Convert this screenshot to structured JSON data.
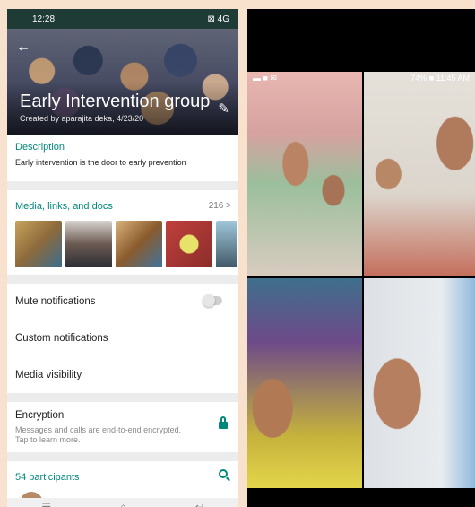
{
  "left_phone": {
    "status": {
      "time": "12:28",
      "right": "⊠ 4G"
    },
    "header": {
      "title": "Early Intervention group",
      "created": "Created by aparajita deka, 4/23/20"
    },
    "description": {
      "label": "Description",
      "text": "Early intervention is the door to early prevention"
    },
    "media": {
      "label": "Media, links, and docs",
      "count": "216 >"
    },
    "settings": {
      "mute": "Mute notifications",
      "custom": "Custom notifications",
      "visibility": "Media visibility"
    },
    "encryption": {
      "title": "Encryption",
      "line1": "Messages and calls are end-to-end encrypted.",
      "line2": "Tap to learn more."
    },
    "participants": {
      "label": "54 participants"
    },
    "nav": {
      "menu": "☰",
      "home": "⌂",
      "back": "↩"
    }
  },
  "right_phone": {
    "status": {
      "left": "▬ ■ ✉",
      "right": "74% ■ 11:45 AM"
    }
  },
  "colors": {
    "accent": "#00897b"
  }
}
